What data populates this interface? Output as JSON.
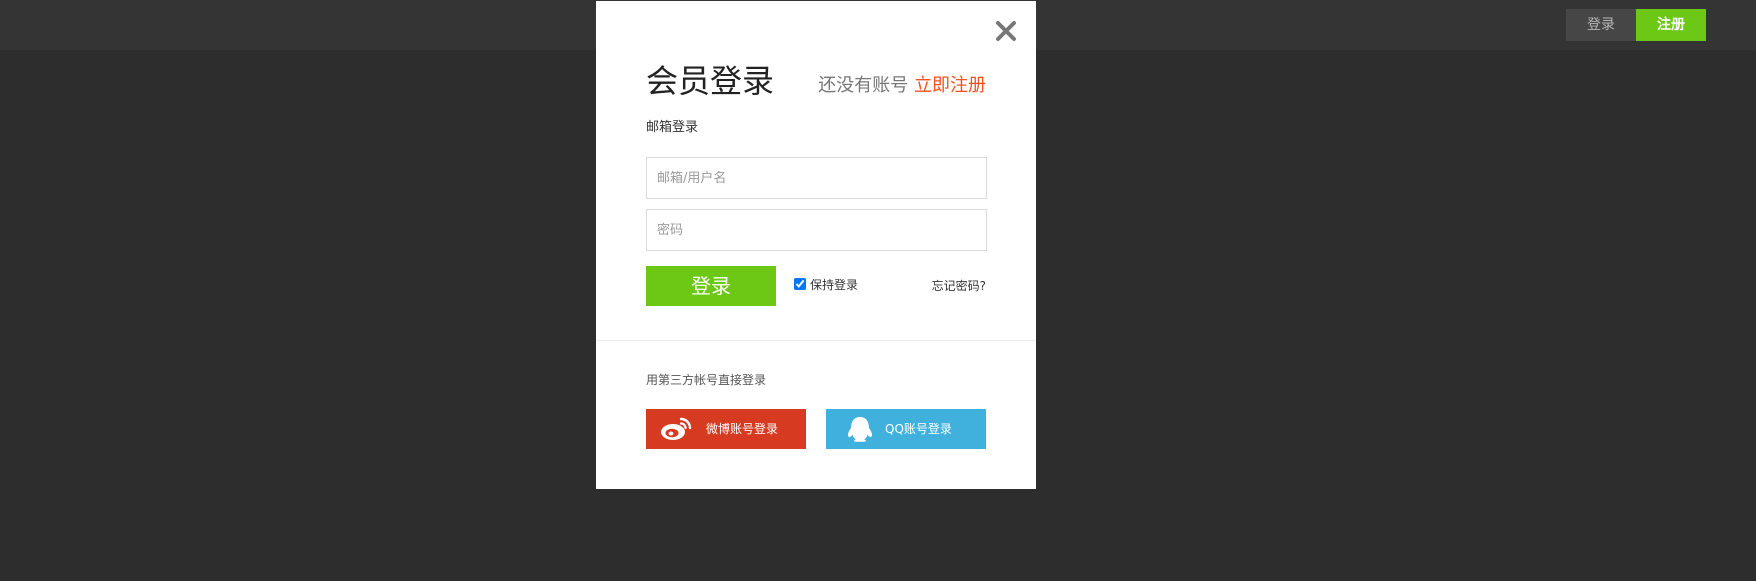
{
  "topbar": {
    "login_label": "登录",
    "register_label": "注册"
  },
  "modal": {
    "close_icon": "close-icon",
    "title": "会员登录",
    "no_account_text": "还没有账号",
    "register_now": "立即注册",
    "email_login_label": "邮箱登录",
    "username_placeholder": "邮箱/用户名",
    "username_value": "",
    "password_placeholder": "密码",
    "password_value": "",
    "login_button": "登录",
    "remember_label": "保持登录",
    "remember_checked": true,
    "forgot_password": "忘记密码?",
    "third_party_label": "用第三方帐号直接登录",
    "weibo_button": "微博账号登录",
    "qq_button": "QQ账号登录"
  },
  "colors": {
    "accent_green": "#6dc816",
    "register_link": "#f4511e",
    "weibo_red": "#d63b22",
    "qq_blue": "#40b1dc",
    "background": "#2d2d2d"
  }
}
